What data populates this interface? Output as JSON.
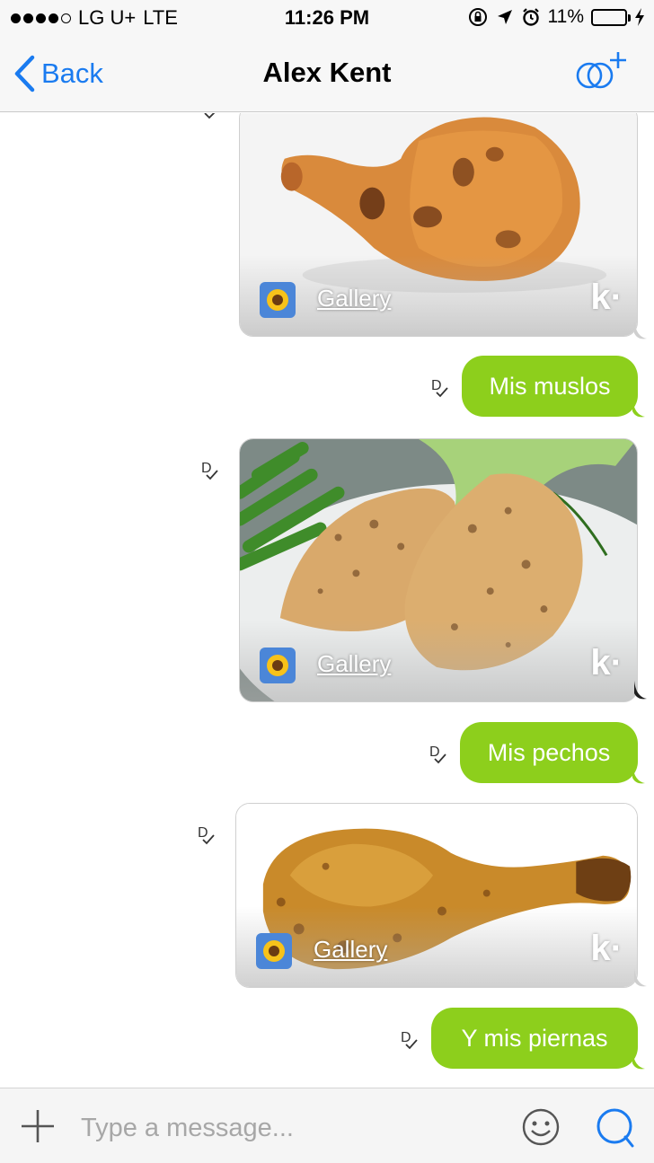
{
  "status_bar": {
    "carrier": "LG U+",
    "network": "LTE",
    "time": "11:26 PM",
    "battery": "11%",
    "battery_level": 0.11,
    "icons": [
      "rotation-lock-icon",
      "location-arrow-icon",
      "alarm-icon",
      "charging-bolt-icon"
    ]
  },
  "nav": {
    "back_label": "Back",
    "title": "Alex Kent",
    "icons": [
      "chevron-left-icon",
      "add-people-icon"
    ]
  },
  "messages": [
    {
      "type": "photo",
      "food": "roasted chicken thigh",
      "link_label": "Gallery",
      "logo": "k·"
    },
    {
      "type": "text",
      "text": "Mis muslos",
      "status": "D"
    },
    {
      "type": "photo",
      "food": "grilled chicken breasts",
      "link_label": "Gallery",
      "logo": "k·",
      "status": "D"
    },
    {
      "type": "text",
      "text": "Mis pechos",
      "status": "D"
    },
    {
      "type": "photo",
      "food": "roasted chicken drumstick",
      "link_label": "Gallery",
      "logo": "k·",
      "status": "D"
    },
    {
      "type": "text",
      "text": "Y mis piernas",
      "status": "D"
    }
  ],
  "input": {
    "placeholder": "Type a message...",
    "icons": [
      "plus-icon",
      "emoji-icon",
      "search-icon"
    ]
  },
  "colors": {
    "accent_blue": "#1a7bf0",
    "bubble_green": "#8dcf1c",
    "bar_background": "#f7f7f7"
  }
}
